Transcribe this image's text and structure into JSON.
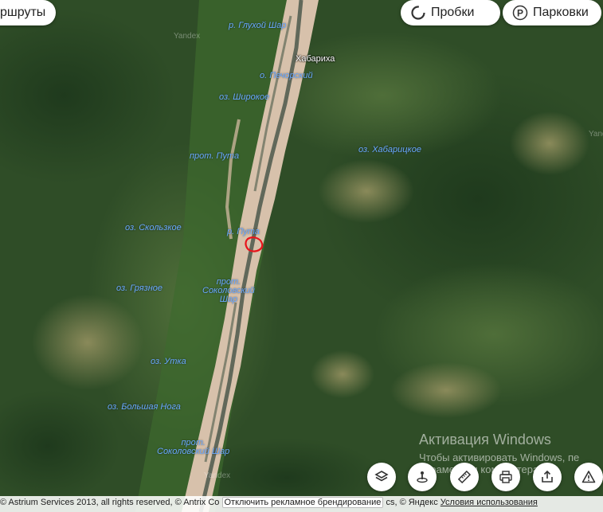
{
  "toolbar": {
    "routes_label": "ршруты",
    "traffic_label": "Пробки",
    "parking_label": "Парковки"
  },
  "map": {
    "water_labels": [
      "р. Глухой Шар",
      "о. Печорский",
      "оз. Широкое",
      "прот. Пута",
      "оз. Хабарицкое",
      "оз. Скользкое",
      "р. Пута",
      "прот.\nСоколовский\nШар",
      "оз. Грязное",
      "оз. Утка",
      "оз. Большая Нога",
      "прот.\nСоколовский Шар"
    ],
    "town": "Хабариха",
    "watermark": "Yandex",
    "watermark_partial": "Yand"
  },
  "tools": {
    "icons": [
      "layers-icon",
      "panorama-icon",
      "ruler-icon",
      "print-icon",
      "share-icon",
      "warning-icon"
    ]
  },
  "activation": {
    "title": "Активация Windows",
    "line1": "Чтобы активировать Windows, пе",
    "line2": "параметрам компьютера."
  },
  "footer": {
    "copyright": "© Astrium Services 2013, all rights reserved, © Antrix Co",
    "ad_button": "Отключить рекламное брендирование",
    "rest": "cs, © Яндекс",
    "terms": "Условия использования"
  },
  "colors": {
    "water_label": "#6aa9ff",
    "river_sand": "#d7c1ab",
    "forest": "#2c4a25",
    "marker": "#e8141c"
  }
}
